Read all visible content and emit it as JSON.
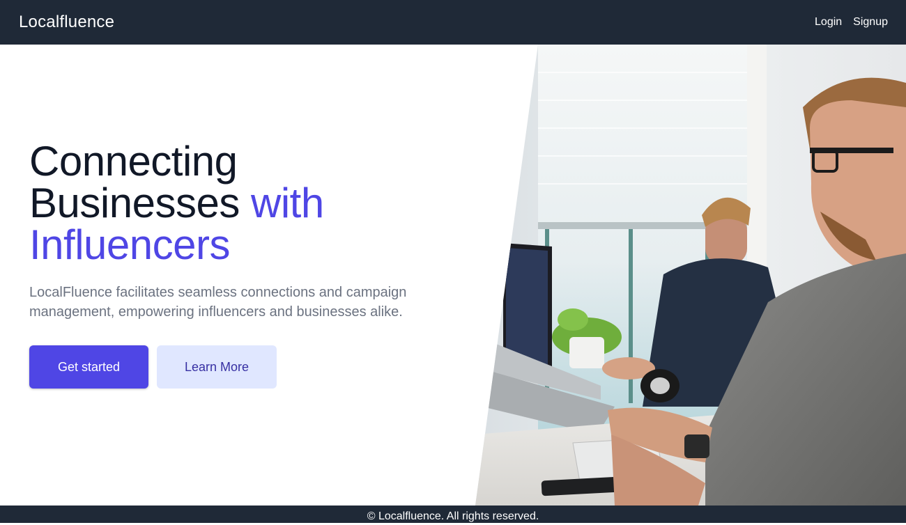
{
  "header": {
    "brand": "Localfluence",
    "nav": {
      "login": "Login",
      "signup": "Signup"
    }
  },
  "hero": {
    "headline_line1": "Connecting",
    "headline_line2": "Businesses ",
    "headline_accent_1": "with",
    "headline_accent_2": "Influencers",
    "subtitle": "LocalFluence facilitates seamless connections and campaign management, empowering influencers and businesses alike.",
    "cta_primary": "Get started",
    "cta_secondary": "Learn More"
  },
  "footer": {
    "copyright": "© Localfluence. All rights reserved."
  },
  "colors": {
    "nav_bg": "#1f2937",
    "accent": "#4f46e5",
    "secondary_bg": "#e0e7ff",
    "text_dark": "#111827",
    "text_muted": "#6b7280"
  }
}
